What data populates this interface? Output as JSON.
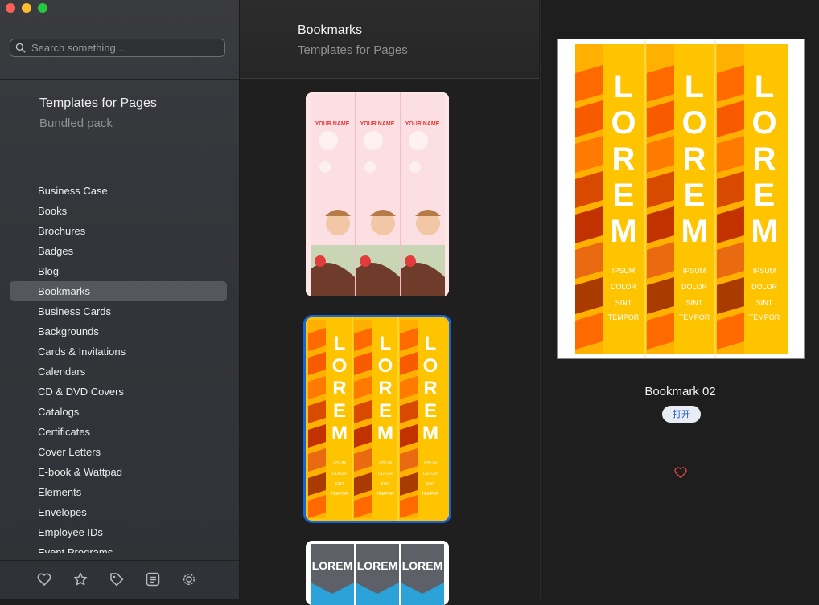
{
  "search": {
    "placeholder": "Search something..."
  },
  "pack": {
    "title": "Templates for Pages",
    "subtitle": "Bundled pack"
  },
  "sidebar": {
    "items": [
      {
        "label": "Business Case"
      },
      {
        "label": "Books"
      },
      {
        "label": "Brochures"
      },
      {
        "label": "Badges"
      },
      {
        "label": "Blog"
      },
      {
        "label": "Bookmarks",
        "active": true
      },
      {
        "label": "Business Cards"
      },
      {
        "label": "Backgrounds"
      },
      {
        "label": "Cards & Invitations"
      },
      {
        "label": "Calendars"
      },
      {
        "label": "CD & DVD Covers"
      },
      {
        "label": "Catalogs"
      },
      {
        "label": "Certificates"
      },
      {
        "label": "Cover Letters"
      },
      {
        "label": "E-book & Wattpad"
      },
      {
        "label": "Elements"
      },
      {
        "label": "Envelopes"
      },
      {
        "label": "Employee IDs"
      },
      {
        "label": "Event Programs"
      }
    ],
    "bottom_icons": [
      "heart-icon",
      "star-icon",
      "tag-icon",
      "list-icon",
      "gear-icon"
    ]
  },
  "category": {
    "title": "Bookmarks",
    "subtitle": "Templates for Pages"
  },
  "thumbnails": [
    {
      "name": "YOUR NAME"
    },
    {
      "name": "LOREM",
      "lines": [
        "IPSUM",
        "DOLOR",
        "SINT",
        "TEMPOR"
      ],
      "selected": true
    },
    {
      "name": "LOREM"
    }
  ],
  "preview": {
    "title": "Bookmark 02",
    "open_label": "打开",
    "word": "LOREM",
    "lines": [
      "IPSUM",
      "DOLOR",
      "SINT",
      "TEMPOR"
    ]
  },
  "colors": {
    "accent": "#1565d8",
    "bookmark_yellow": "#ffc400",
    "bookmark_orange": "#ff6a00",
    "heart": "#e0443e"
  }
}
